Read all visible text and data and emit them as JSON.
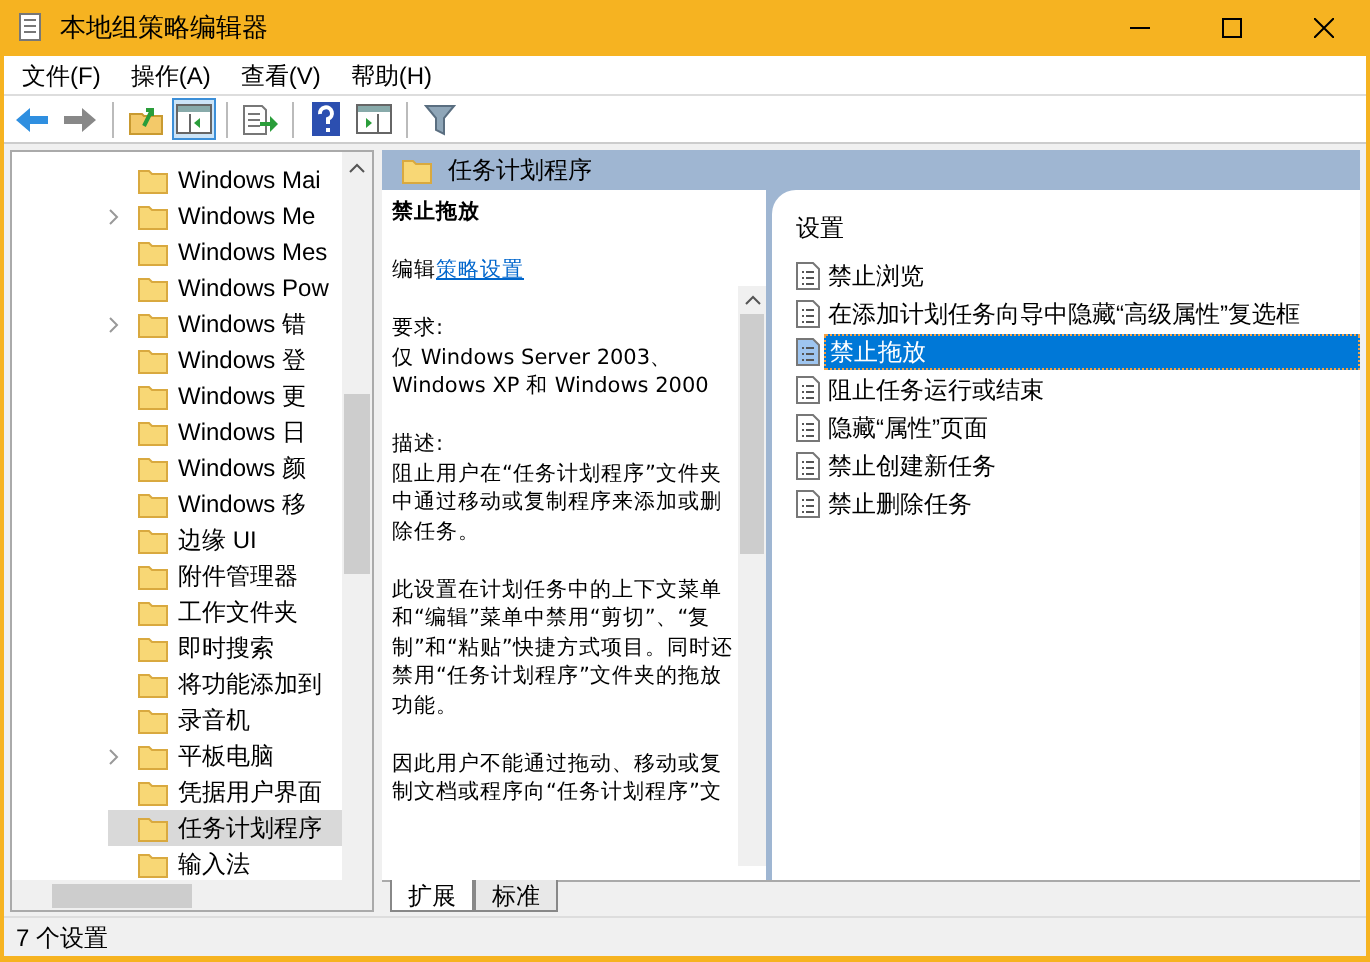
{
  "window": {
    "title": "本地组策略编辑器"
  },
  "menu": [
    "文件(F)",
    "操作(A)",
    "查看(V)",
    "帮助(H)"
  ],
  "toolbar": [
    {
      "kind": "back",
      "pressed": false
    },
    {
      "kind": "forward",
      "pressed": false
    },
    {
      "kind": "sep"
    },
    {
      "kind": "up",
      "pressed": false
    },
    {
      "kind": "tree",
      "pressed": true
    },
    {
      "kind": "sep"
    },
    {
      "kind": "export",
      "pressed": false
    },
    {
      "kind": "sep"
    },
    {
      "kind": "help",
      "pressed": false
    },
    {
      "kind": "pane",
      "pressed": false
    },
    {
      "kind": "sep"
    },
    {
      "kind": "filter",
      "pressed": false
    }
  ],
  "tree": [
    {
      "label": "Windows Mai",
      "expandable": false,
      "selected": false
    },
    {
      "label": "Windows Me",
      "expandable": true,
      "selected": false
    },
    {
      "label": "Windows Mes",
      "expandable": false,
      "selected": false
    },
    {
      "label": "Windows Pow",
      "expandable": false,
      "selected": false
    },
    {
      "label": "Windows 错",
      "expandable": true,
      "selected": false
    },
    {
      "label": "Windows 登",
      "expandable": false,
      "selected": false
    },
    {
      "label": "Windows 更",
      "expandable": false,
      "selected": false
    },
    {
      "label": "Windows 日",
      "expandable": false,
      "selected": false
    },
    {
      "label": "Windows 颜",
      "expandable": false,
      "selected": false
    },
    {
      "label": "Windows 移",
      "expandable": false,
      "selected": false
    },
    {
      "label": "边缘 UI",
      "expandable": false,
      "selected": false
    },
    {
      "label": "附件管理器",
      "expandable": false,
      "selected": false
    },
    {
      "label": "工作文件夹",
      "expandable": false,
      "selected": false
    },
    {
      "label": "即时搜索",
      "expandable": false,
      "selected": false
    },
    {
      "label": "将功能添加到",
      "expandable": false,
      "selected": false
    },
    {
      "label": "录音机",
      "expandable": false,
      "selected": false
    },
    {
      "label": "平板电脑",
      "expandable": true,
      "selected": false
    },
    {
      "label": "凭据用户界面",
      "expandable": false,
      "selected": false
    },
    {
      "label": "任务计划程序",
      "expandable": false,
      "selected": true
    },
    {
      "label": "输入法",
      "expandable": false,
      "selected": false
    }
  ],
  "header": {
    "title": "任务计划程序"
  },
  "description": {
    "title": "禁止拖放",
    "edit_prefix": "编辑",
    "edit_link": "策略设置",
    "paragraphs": [
      [
        "要求:",
        "仅 Windows Server 2003、",
        "Windows XP 和 Windows 2000"
      ],
      [
        "描述:",
        "阻止用户在“任务计划程序”文件夹",
        "中通过移动或复制程序来添加或删",
        "除任务。"
      ],
      [
        "此设置在计划任务中的上下文菜单",
        "和“编辑”菜单中禁用“剪切”、“复",
        "制”和“粘贴”快捷方式项目。同时还",
        "禁用“任务计划程序”文件夹的拖放",
        "功能。"
      ],
      [
        "因此用户不能通过拖动、移动或复",
        "制文档或程序向“任务计划程序”文"
      ]
    ]
  },
  "settings": {
    "column": "设置",
    "items": [
      {
        "label": "禁止浏览",
        "selected": false
      },
      {
        "label": "在添加计划任务向导中隐藏“高级属性”复选框",
        "selected": false
      },
      {
        "label": "禁止拖放",
        "selected": true
      },
      {
        "label": "阻止任务运行或结束",
        "selected": false
      },
      {
        "label": "隐藏“属性”页面",
        "selected": false
      },
      {
        "label": "禁止创建新任务",
        "selected": false
      },
      {
        "label": "禁止删除任务",
        "selected": false
      }
    ]
  },
  "tabs": [
    {
      "label": "扩展",
      "selected": true
    },
    {
      "label": "标准",
      "selected": false
    }
  ],
  "status_bar": "7 个设置"
}
